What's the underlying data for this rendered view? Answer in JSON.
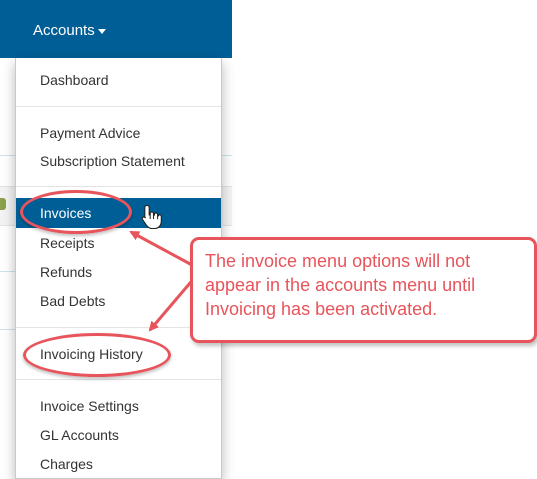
{
  "nav": {
    "accounts_label": "Accounts"
  },
  "menu": {
    "items": [
      {
        "label": "Dashboard"
      },
      {
        "label": "Payment Advice"
      },
      {
        "label": "Subscription Statement"
      },
      {
        "label": "Invoices",
        "active": true
      },
      {
        "label": "Receipts"
      },
      {
        "label": "Refunds"
      },
      {
        "label": "Bad Debts"
      },
      {
        "label": "Invoicing History"
      },
      {
        "label": "Invoice Settings"
      },
      {
        "label": "GL Accounts"
      },
      {
        "label": "Charges"
      }
    ]
  },
  "callout": {
    "text": "The invoice menu options will not appear in the accounts menu until Invoicing has been activated."
  },
  "colors": {
    "nav_bg": "#005e96",
    "active_bg": "#005e96",
    "annotation_red": "#e8545b"
  },
  "icons": {
    "pointer": "hand-pointer-icon",
    "caret": "caret-down-icon"
  }
}
